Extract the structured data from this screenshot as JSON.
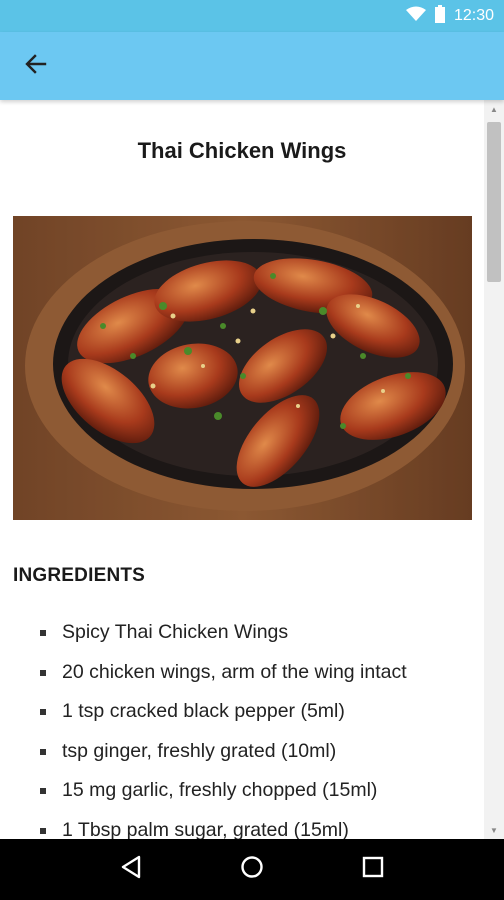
{
  "status_bar": {
    "time": "12:30",
    "icons": [
      "wifi-icon",
      "battery-icon"
    ],
    "color": "#5bc3e7"
  },
  "app_bar": {
    "back_icon": "arrow-back-icon",
    "color": "#6cc8f2"
  },
  "recipe": {
    "title": "Thai Chicken Wings",
    "image_subject": "food-photo",
    "section_heading": "INGREDIENTS",
    "ingredients": [
      "Spicy Thai Chicken Wings",
      "20 chicken wings, arm of the wing intact",
      "1 tsp cracked black pepper (5ml)",
      "tsp ginger, freshly grated (10ml)",
      "15 mg garlic, freshly chopped (15ml)",
      "1 Tbsp palm sugar, grated (15ml)"
    ]
  },
  "nav_bar": {
    "buttons": [
      "back-triangle-icon",
      "home-circle-icon",
      "recents-square-icon"
    ]
  }
}
